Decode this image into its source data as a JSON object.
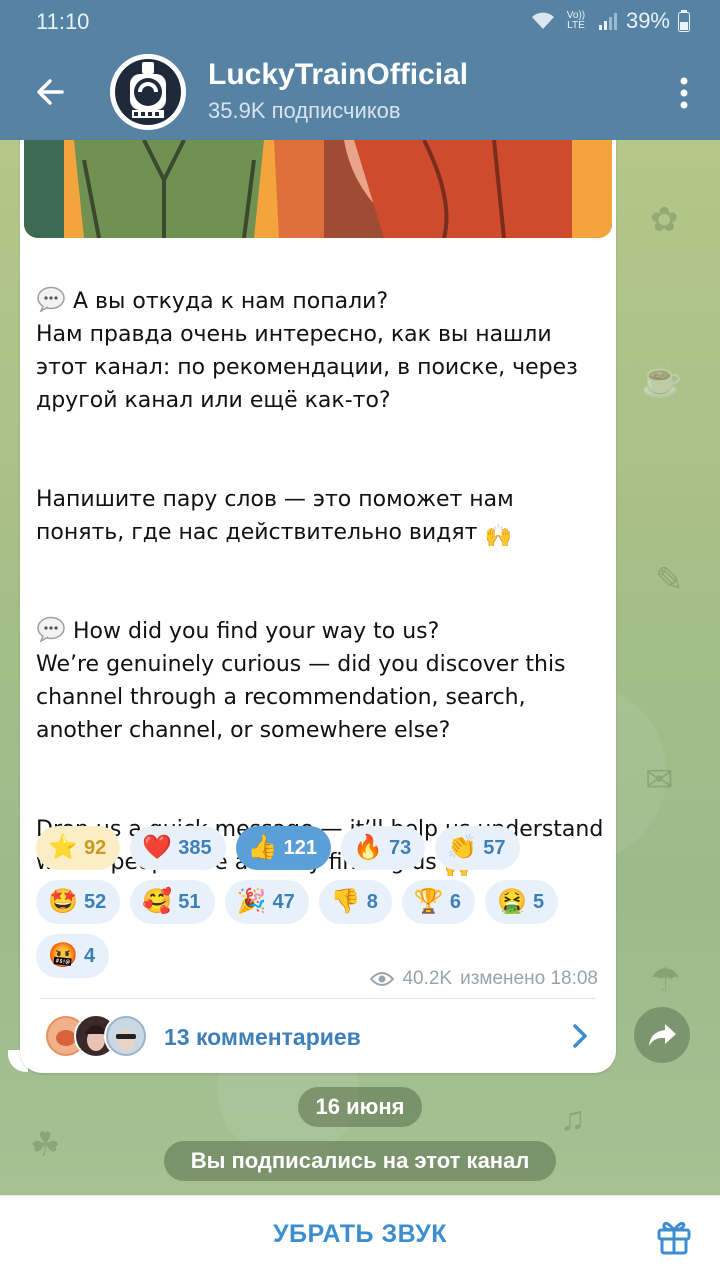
{
  "status": {
    "time": "11:10",
    "volte": "Vo)) LTE",
    "battery": "39%"
  },
  "header": {
    "title": "LuckyTrainOfficial",
    "subtitle": "35.9K подписчиков"
  },
  "message": {
    "paragraphs": [
      {
        "lead_icon": "speech-bubble",
        "text": "А вы откуда к нам попали?\nНам правда очень интересно, как вы нашли этот канал: по рекомендации, в поиске, через другой канал или ещё как-то?"
      },
      {
        "text": "Напишите пару слов — это поможет нам понять, где нас действительно видят",
        "trail_icon": "raised-hands"
      },
      {
        "lead_icon": "speech-bubble",
        "text": "How did you find your way to us?\nWe’re genuinely curious — did you discover this channel through a recommendation, search, another channel, or somewhere else?"
      },
      {
        "text": "Drop us a quick message — it’ll help us understand where people are actually finding us",
        "trail_icon": "raised-hands"
      }
    ],
    "reactions": [
      {
        "emoji": "⭐",
        "count": "92",
        "kind": "star"
      },
      {
        "emoji": "❤️",
        "count": "385"
      },
      {
        "emoji": "👍",
        "count": "121",
        "kind": "mine"
      },
      {
        "emoji": "🔥",
        "count": "73"
      },
      {
        "emoji": "👏",
        "count": "57"
      },
      {
        "emoji": "🤩",
        "count": "52"
      },
      {
        "emoji": "🥰",
        "count": "51"
      },
      {
        "emoji": "🎉",
        "count": "47"
      },
      {
        "emoji": "👎",
        "count": "8"
      },
      {
        "emoji": "🏆",
        "count": "6"
      },
      {
        "emoji": "🤮",
        "count": "5"
      },
      {
        "emoji": "🤬",
        "count": "4"
      }
    ],
    "views": "40.2K",
    "edited": "изменено 18:08",
    "comments_label": "13 комментариев"
  },
  "date_pill": "16 июня",
  "service_message": "Вы подписались на этот канал",
  "bottom": {
    "mute_label": "УБРАТЬ ЗВУК"
  },
  "colors": {
    "header": "#5682a3",
    "accent": "#3d8ed0",
    "reaction_bg": "#e8f1f9",
    "reaction_mine": "#5a9fd8"
  }
}
